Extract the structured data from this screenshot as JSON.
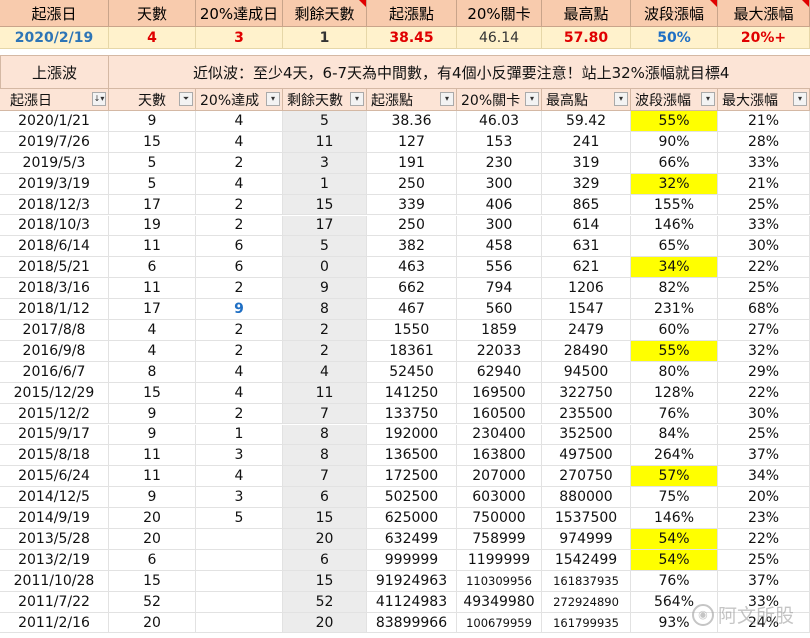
{
  "header": [
    "起漲日",
    "天數",
    "20%達成日",
    "剩餘天數",
    "起漲點",
    "20%關卡",
    "最高點",
    "波段漲幅",
    "最大漲幅"
  ],
  "summary": [
    "2020/2/19",
    "4",
    "3",
    "1",
    "38.45",
    "46.14",
    "57.80",
    "50%",
    "20%+"
  ],
  "banner": {
    "label": "上漲波",
    "message": "近似波：至少4天，6-7天為中間數，有4個小反彈要注意！站上32%漲幅就目標4"
  },
  "filter_header": [
    "起漲日",
    "天數",
    "20%達成",
    "剩餘天數",
    "起漲點",
    "20%關卡",
    "最高點",
    "波段漲幅",
    "最大漲幅"
  ],
  "rows": [
    [
      "2020/1/21",
      "9",
      "4",
      "5",
      "38.36",
      "46.03",
      "59.42",
      "55%",
      "21%"
    ],
    [
      "2019/7/26",
      "15",
      "4",
      "11",
      "127",
      "153",
      "241",
      "90%",
      "28%"
    ],
    [
      "2019/5/3",
      "5",
      "2",
      "3",
      "191",
      "230",
      "319",
      "66%",
      "33%"
    ],
    [
      "2019/3/19",
      "5",
      "4",
      "1",
      "250",
      "300",
      "329",
      "32%",
      "21%"
    ],
    [
      "2018/12/3",
      "17",
      "2",
      "15",
      "339",
      "406",
      "865",
      "155%",
      "25%"
    ],
    [
      "2018/10/3",
      "19",
      "2",
      "17",
      "250",
      "300",
      "614",
      "146%",
      "33%"
    ],
    [
      "2018/6/14",
      "11",
      "6",
      "5",
      "382",
      "458",
      "631",
      "65%",
      "30%"
    ],
    [
      "2018/5/21",
      "6",
      "6",
      "0",
      "463",
      "556",
      "621",
      "34%",
      "22%"
    ],
    [
      "2018/3/16",
      "11",
      "2",
      "9",
      "662",
      "794",
      "1206",
      "82%",
      "25%"
    ],
    [
      "2018/1/12",
      "17",
      "9",
      "8",
      "467",
      "560",
      "1547",
      "231%",
      "68%"
    ],
    [
      "2017/8/8",
      "4",
      "2",
      "2",
      "1550",
      "1859",
      "2479",
      "60%",
      "27%"
    ],
    [
      "2016/9/8",
      "4",
      "2",
      "2",
      "18361",
      "22033",
      "28490",
      "55%",
      "32%"
    ],
    [
      "2016/6/7",
      "8",
      "4",
      "4",
      "52450",
      "62940",
      "94500",
      "80%",
      "29%"
    ],
    [
      "2015/12/29",
      "15",
      "4",
      "11",
      "141250",
      "169500",
      "322750",
      "128%",
      "22%"
    ],
    [
      "2015/12/2",
      "9",
      "2",
      "7",
      "133750",
      "160500",
      "235500",
      "76%",
      "30%"
    ],
    [
      "2015/9/17",
      "9",
      "1",
      "8",
      "192000",
      "230400",
      "352500",
      "84%",
      "25%"
    ],
    [
      "2015/8/18",
      "11",
      "3",
      "8",
      "136500",
      "163800",
      "497500",
      "264%",
      "37%"
    ],
    [
      "2015/6/24",
      "11",
      "4",
      "7",
      "172500",
      "207000",
      "270750",
      "57%",
      "34%"
    ],
    [
      "2014/12/5",
      "9",
      "3",
      "6",
      "502500",
      "603000",
      "880000",
      "75%",
      "20%"
    ],
    [
      "2014/9/19",
      "20",
      "5",
      "15",
      "625000",
      "750000",
      "1537500",
      "146%",
      "23%"
    ],
    [
      "2013/5/28",
      "20",
      "",
      "20",
      "632499",
      "758999",
      "974999",
      "54%",
      "22%"
    ],
    [
      "2013/2/19",
      "6",
      "",
      "6",
      "999999",
      "1199999",
      "1542499",
      "54%",
      "25%"
    ],
    [
      "2011/10/28",
      "15",
      "",
      "15",
      "91924963",
      "110309956",
      "161837935",
      "76%",
      "37%"
    ],
    [
      "2011/7/22",
      "52",
      "",
      "52",
      "41124983",
      "49349980",
      "272924890",
      "564%",
      "33%"
    ],
    [
      "2011/2/16",
      "20",
      "",
      "20",
      "83899966",
      "100679959",
      "161799935",
      "93%",
      "24%"
    ]
  ],
  "highlight_rows": [
    0,
    3,
    7,
    11,
    17,
    20,
    21
  ],
  "watermark": "阿文所股",
  "colors": {
    "header_bg": "#f8cbad",
    "summary_bg": "#fff2cc",
    "banner_bg": "#fce4d6",
    "highlight": "#ffff00",
    "accent_red": "#e00000",
    "accent_blue": "#2e75b6"
  }
}
